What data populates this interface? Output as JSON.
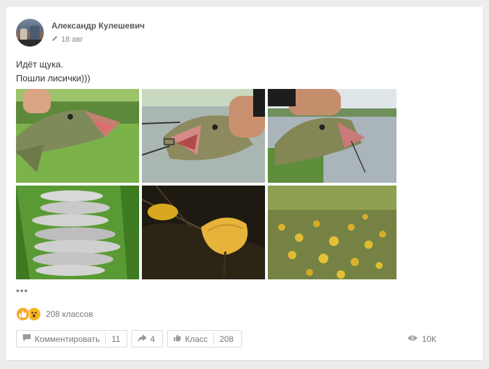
{
  "post": {
    "author": "Александр Кулешевич",
    "date": "18 авг",
    "text_lines": [
      "Идёт щука.",
      "Пошли лисички)))"
    ],
    "photos": [
      {
        "icon": "pike-held-photo"
      },
      {
        "icon": "pike-hook-photo"
      },
      {
        "icon": "pike-lake-photo"
      },
      {
        "icon": "fish-on-grass-photo"
      },
      {
        "icon": "chanterelle-closeup-photo"
      },
      {
        "icon": "chanterelles-forest-photo"
      }
    ],
    "more_label": "•••"
  },
  "reactions": {
    "count_label": "208 классов"
  },
  "actions": {
    "comment_label": "Комментировать",
    "comment_count": "11",
    "share_count": "4",
    "like_label": "Класс",
    "like_count": "208",
    "views": "10K"
  },
  "colors": {
    "card_bg": "#ffffff",
    "page_bg": "#ededed",
    "reaction_orange": "#f7a92d"
  }
}
